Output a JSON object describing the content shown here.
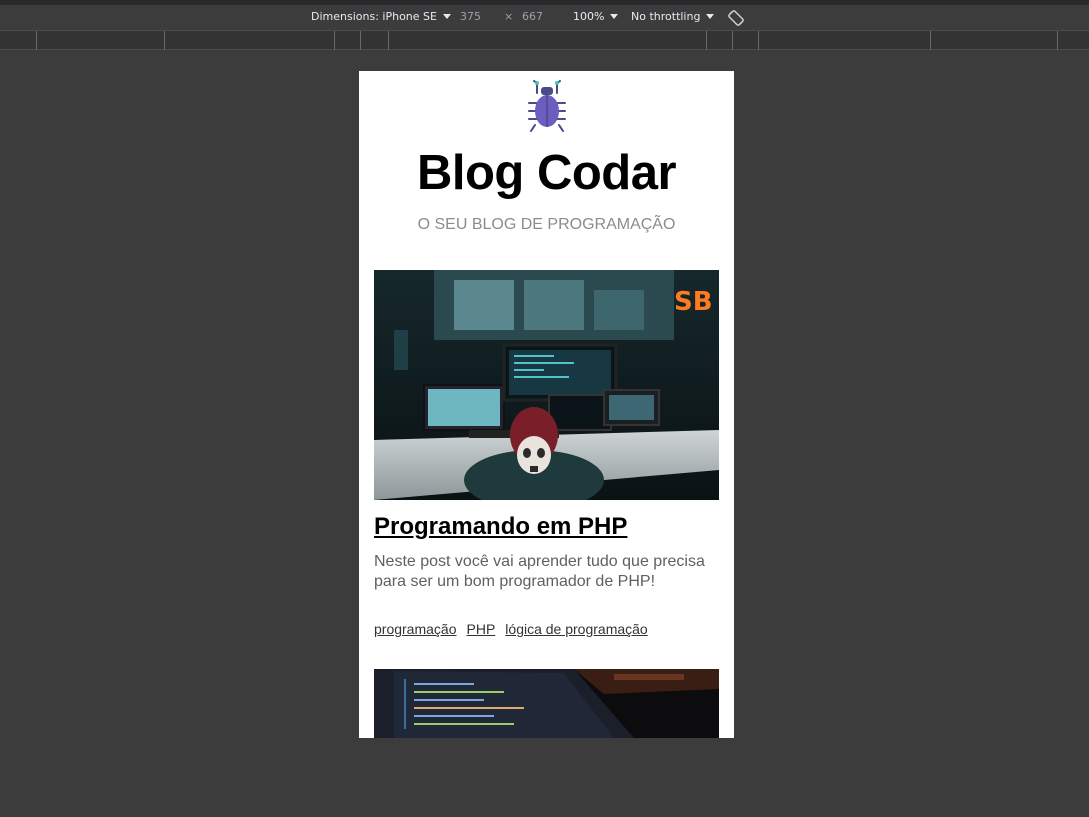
{
  "devtools": {
    "dimensions_label": "Dimensions: iPhone SE",
    "width": "375",
    "times": "×",
    "height": "667",
    "zoom": "100%",
    "throttling": "No throttling",
    "rotate_icon": "rotate-icon"
  },
  "page": {
    "logo_icon": "bug-icon",
    "title": "Blog Codar",
    "subtitle": "O SEU BLOG DE PROGRAMAÇÃO",
    "posts": [
      {
        "title": "Programando em PHP",
        "excerpt": "Neste post você vai aprender tudo que precisa para ser um bom programador de PHP!",
        "tags": [
          "programação",
          "PHP",
          "lógica de programação"
        ]
      }
    ]
  },
  "colors": {
    "devtools_bg": "#3c3c3c",
    "page_bg": "#ffffff",
    "subtitle": "#8c8c8c",
    "bug_body": "#6a5fc1",
    "bug_legs": "#4a4a8a"
  }
}
